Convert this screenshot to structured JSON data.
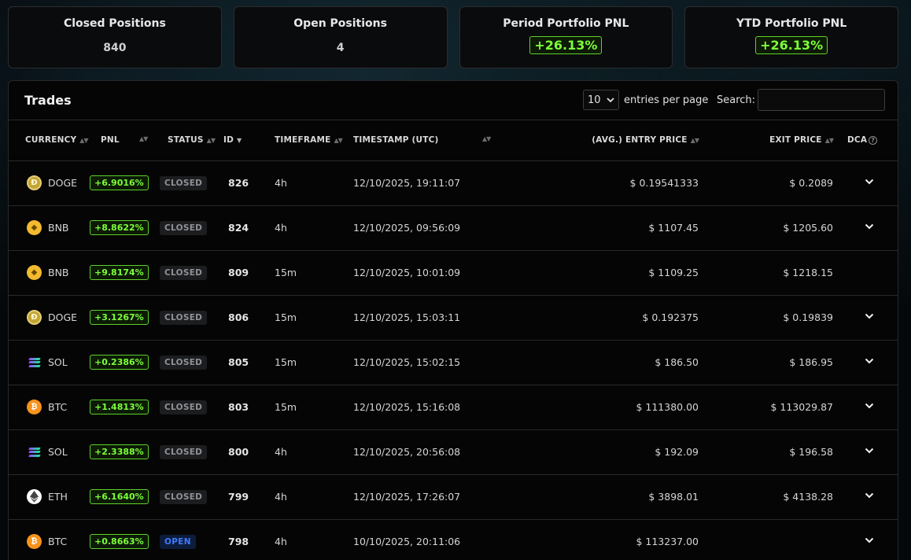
{
  "summary_cards": [
    {
      "title": "Closed Positions",
      "value": "840",
      "type": "plain"
    },
    {
      "title": "Open Positions",
      "value": "4",
      "type": "plain"
    },
    {
      "title": "Period Portfolio PNL",
      "value": "+26.13%",
      "type": "pnl"
    },
    {
      "title": "YTD Portfolio PNL",
      "value": "+26.13%",
      "type": "pnl"
    }
  ],
  "trades": {
    "title": "Trades",
    "entries_value": "10",
    "entries_label": "entries per page",
    "search_label": "Search:",
    "search_value": "",
    "columns": {
      "currency": "CURRENCY",
      "pnl": "PNL",
      "status": "STATUS",
      "id": "ID",
      "timeframe": "TIMEFRAME",
      "timestamp": "TIMESTAMP (UTC)",
      "entry_price": "(AVG.) ENTRY PRICE",
      "exit_price": "EXIT PRICE",
      "dca": "DCA"
    },
    "rows": [
      {
        "currency": "DOGE",
        "icon": "doge-icon",
        "pnl": "+6.9016%",
        "status": "CLOSED",
        "id": "826",
        "timeframe": "4h",
        "timestamp": "12/10/2025, 19:11:07",
        "entry_price": "$ 0.19541333",
        "exit_price": "$ 0.2089",
        "expandable": true
      },
      {
        "currency": "BNB",
        "icon": "bnb-icon",
        "pnl": "+8.8622%",
        "status": "CLOSED",
        "id": "824",
        "timeframe": "4h",
        "timestamp": "12/10/2025, 09:56:09",
        "entry_price": "$ 1107.45",
        "exit_price": "$ 1205.60",
        "expandable": true
      },
      {
        "currency": "BNB",
        "icon": "bnb-icon",
        "pnl": "+9.8174%",
        "status": "CLOSED",
        "id": "809",
        "timeframe": "15m",
        "timestamp": "12/10/2025, 10:01:09",
        "entry_price": "$ 1109.25",
        "exit_price": "$ 1218.15",
        "expandable": false
      },
      {
        "currency": "DOGE",
        "icon": "doge-icon",
        "pnl": "+3.1267%",
        "status": "CLOSED",
        "id": "806",
        "timeframe": "15m",
        "timestamp": "12/10/2025, 15:03:11",
        "entry_price": "$ 0.192375",
        "exit_price": "$ 0.19839",
        "expandable": true
      },
      {
        "currency": "SOL",
        "icon": "sol-icon",
        "pnl": "+0.2386%",
        "status": "CLOSED",
        "id": "805",
        "timeframe": "15m",
        "timestamp": "12/10/2025, 15:02:15",
        "entry_price": "$ 186.50",
        "exit_price": "$ 186.95",
        "expandable": true
      },
      {
        "currency": "BTC",
        "icon": "btc-icon",
        "pnl": "+1.4813%",
        "status": "CLOSED",
        "id": "803",
        "timeframe": "15m",
        "timestamp": "12/10/2025, 15:16:08",
        "entry_price": "$ 111380.00",
        "exit_price": "$ 113029.87",
        "expandable": true
      },
      {
        "currency": "SOL",
        "icon": "sol-icon",
        "pnl": "+2.3388%",
        "status": "CLOSED",
        "id": "800",
        "timeframe": "4h",
        "timestamp": "12/10/2025, 20:56:08",
        "entry_price": "$ 192.09",
        "exit_price": "$ 196.58",
        "expandable": true
      },
      {
        "currency": "ETH",
        "icon": "eth-icon",
        "pnl": "+6.1640%",
        "status": "CLOSED",
        "id": "799",
        "timeframe": "4h",
        "timestamp": "12/10/2025, 17:26:07",
        "entry_price": "$ 3898.01",
        "exit_price": "$ 4138.28",
        "expandable": true
      },
      {
        "currency": "BTC",
        "icon": "btc-icon",
        "pnl": "+0.8663%",
        "status": "OPEN",
        "id": "798",
        "timeframe": "4h",
        "timestamp": "10/10/2025, 20:11:06",
        "entry_price": "$ 113237.00",
        "exit_price": "",
        "expandable": true
      }
    ]
  },
  "colors": {
    "pnl_green": "#7dff3a",
    "open_blue": "#3d7cff",
    "closed_gray": "#8f9296"
  }
}
